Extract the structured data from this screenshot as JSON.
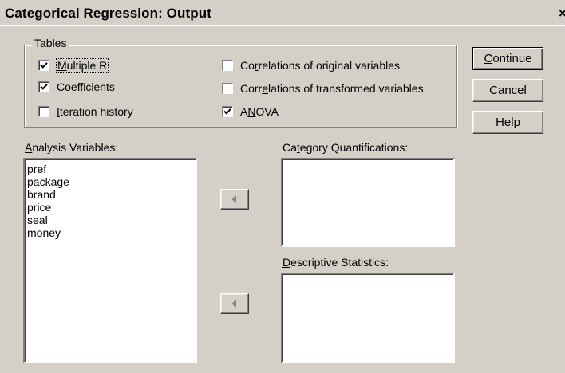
{
  "window": {
    "title": "Categorical Regression: Output",
    "close_glyph": "×"
  },
  "tables": {
    "legend": "Tables",
    "checkboxes": [
      {
        "label_pre": "",
        "label_ul": "M",
        "label_post": "ultiple R",
        "checked": true
      },
      {
        "label_pre": "C",
        "label_ul": "o",
        "label_post": "efficients",
        "checked": true
      },
      {
        "label_pre": "",
        "label_ul": "I",
        "label_post": "teration history",
        "checked": false
      },
      {
        "label_pre": "Co",
        "label_ul": "r",
        "label_post": "relations of original variables",
        "checked": false
      },
      {
        "label_pre": "Corr",
        "label_ul": "e",
        "label_post": "lations of transformed variables",
        "checked": false
      },
      {
        "label_pre": "A",
        "label_ul": "N",
        "label_post": "OVA",
        "checked": true
      }
    ]
  },
  "buttons": {
    "continue_ul": "C",
    "continue_rest": "ontinue",
    "cancel": "Cancel",
    "help": "Help"
  },
  "analysis_variables": {
    "label_ul": "A",
    "label_rest": "nalysis Variables:",
    "items": [
      "pref",
      "package",
      "brand",
      "price",
      "seal",
      "money"
    ]
  },
  "category_quantifications": {
    "label_pre": "Ca",
    "label_ul": "t",
    "label_post": "egory Quantifications:",
    "items": []
  },
  "descriptive_statistics": {
    "label_ul": "D",
    "label_rest": "escriptive Statistics:",
    "items": []
  },
  "icons": {
    "move_left": "left-arrow-icon",
    "check": "check-icon",
    "close": "close-icon"
  }
}
